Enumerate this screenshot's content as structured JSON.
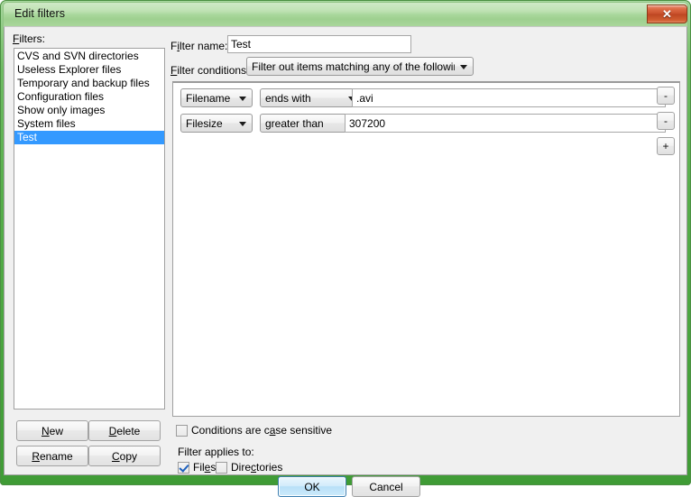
{
  "window": {
    "title": "Edit filters",
    "close_label": "✕",
    "frame_color": "#57ae4b",
    "titlebar_color": "#a8d79b"
  },
  "filters_panel": {
    "label": "Filters:",
    "items": [
      {
        "label": "CVS and SVN directories",
        "selected": false
      },
      {
        "label": "Useless Explorer files",
        "selected": false
      },
      {
        "label": "Temporary and backup files",
        "selected": false
      },
      {
        "label": "Configuration files",
        "selected": false
      },
      {
        "label": "Show only images",
        "selected": false
      },
      {
        "label": "System files",
        "selected": false
      },
      {
        "label": "Test",
        "selected": true
      }
    ],
    "selection_color": "#3399ff",
    "buttons": {
      "new": "New",
      "delete": "Delete",
      "rename": "Rename",
      "copy": "Copy"
    }
  },
  "editor": {
    "filter_name_label": "Filter name:",
    "filter_name_value": "Test",
    "filter_name_placeholder": "",
    "filter_conditions_label": "Filter conditions:",
    "filter_conditions_value": "Filter out items matching any of the following",
    "conditions": [
      {
        "field": "Filename",
        "operator": "ends with",
        "value": ".avi",
        "remove_label": "-"
      },
      {
        "field": "Filesize",
        "operator": "greater than",
        "value": "307200",
        "remove_label": "-"
      }
    ],
    "add_condition_label": "+",
    "case_sensitive_label": "Conditions are case sensitive",
    "case_sensitive_checked": false,
    "applies_to_label": "Filter applies to:",
    "applies_files_label": "Files",
    "applies_files_checked": true,
    "applies_directories_label": "Directories",
    "applies_directories_checked": false
  },
  "footer": {
    "ok_label": "OK",
    "cancel_label": "Cancel"
  }
}
